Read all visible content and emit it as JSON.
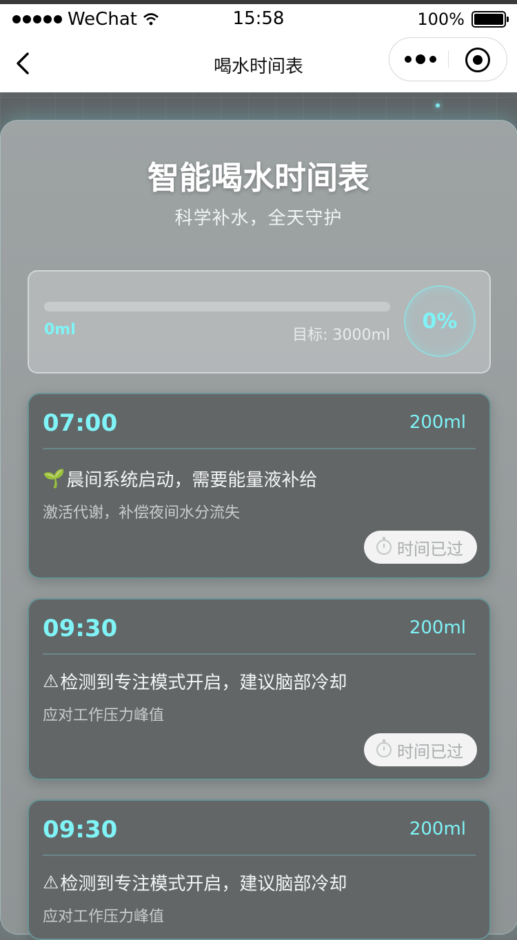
{
  "status_bar": {
    "carrier": "WeChat",
    "time": "15:58",
    "battery": "100%"
  },
  "nav": {
    "title": "喝水时间表"
  },
  "hero": {
    "title": "智能喝水时间表",
    "subtitle": "科学补水，全天守护"
  },
  "progress": {
    "current": "0ml",
    "goal": "目标: 3000ml",
    "percent_text": "0%",
    "fraction": 0
  },
  "schedule": [
    {
      "time": "07:00",
      "amount": "200ml",
      "icon": "🌱",
      "headline": "晨间系统启动，需要能量液补给",
      "desc": "激活代谢，补偿夜间水分流失",
      "status": "时间已过"
    },
    {
      "time": "09:30",
      "amount": "200ml",
      "icon": "⚠",
      "headline": "检测到专注模式开启，建议脑部冷却",
      "desc": "应对工作压力峰值",
      "status": "时间已过"
    },
    {
      "time": "09:30",
      "amount": "200ml",
      "icon": "⚠",
      "headline": "检测到专注模式开启，建议脑部冷却",
      "desc": "应对工作压力峰值",
      "status": ""
    }
  ],
  "colors": {
    "accent": "#7ff3f6"
  }
}
